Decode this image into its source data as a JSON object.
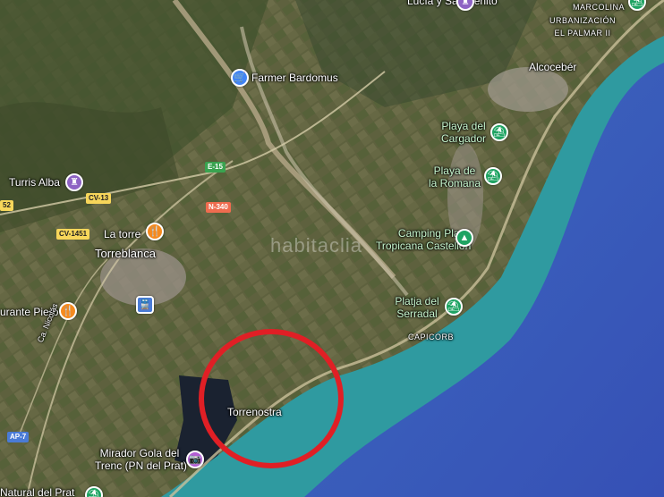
{
  "map": {
    "watermark": "habitaclia",
    "sea_color": "#3a58b8",
    "coast_color": "#2f9aa0",
    "highlight_color": "#e01f25"
  },
  "places": {
    "lucia": "Lucía y San Benito",
    "marcolina": "MARCOLINA",
    "urbanizacion_1": "URBANIZACIÓN",
    "urbanizacion_2": "EL PALMAR II",
    "alcoceber": "Alcocebér",
    "torreblanca": "Torreblanca",
    "torrenostra": "Torrenostra",
    "capicorb": "CAPICORB",
    "turris_alba": "Turris Alba",
    "la_torre": "La torre",
    "restaurante": "urante Piero",
    "natural_prat": "Natural del Prat"
  },
  "pois": {
    "farmer": "Farmer Bardomus",
    "cargador_1": "Playa del",
    "cargador_2": "Cargador",
    "romana_1": "Playa de",
    "romana_2": "la Romana",
    "camping_1": "Camping Playa",
    "camping_2": "Tropicana Castellón",
    "serradal_1": "Platja del",
    "serradal_2": "Serradal",
    "mirador_1": "Mirador Gola del",
    "mirador_2": "Trenc (PN del Prat)"
  },
  "roads": {
    "e15": "E-15",
    "n340": "N-340",
    "cv13": "CV-13",
    "cv1451": "CV-1451",
    "ap7": "AP-7",
    "camino": "Ca. Nicolás",
    "edge": "52"
  },
  "icons": {
    "shop": "shopping-cart-icon",
    "castle": "castle-icon",
    "restaurant": "restaurant-icon",
    "beach": "beach-umbrella-icon",
    "camping": "tent-icon",
    "train": "train-station-icon",
    "camera": "camera-icon"
  }
}
